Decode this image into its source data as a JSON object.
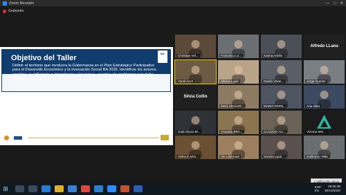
{
  "window": {
    "title": "Zoom Reunión",
    "controls": [
      "—",
      "□",
      "✕"
    ]
  },
  "recording": {
    "label": "Grabando"
  },
  "slide": {
    "title": "Objetivo del Taller",
    "logo_text": "BA",
    "body": "Definir el territorio que involucra la Gobernanza en el Plan Estratégico Participativo para el Desarrollo Económico y la Innovación Social BA 2035. Identificar los actores sociales, su influencia e importancia y los temas, asuntos y/o problemas que debe abordar."
  },
  "participants": [
    {
      "name": "Christian Vel...",
      "type": "video",
      "color": "#5b4a3a"
    },
    {
      "name": "Francisco Lo...",
      "type": "video",
      "color": "#6b6f72"
    },
    {
      "name": "Karina Arbilla",
      "type": "video",
      "color": "#4a4f58"
    },
    {
      "name": "Alfredo LLana",
      "type": "name"
    },
    {
      "name": "Yamil Asch",
      "type": "video",
      "color": "#6d5a43",
      "active": true
    },
    {
      "name": "Silvina Lupis",
      "type": "video",
      "color": "#b9a48a"
    },
    {
      "name": "Danilo Villan...",
      "type": "video",
      "color": "#5a5e66"
    },
    {
      "name": "Jorge Gomez",
      "type": "video",
      "color": "#7a7f86"
    },
    {
      "name": "Silvia Collin",
      "type": "name"
    },
    {
      "name": "Mora ARAUJO...",
      "type": "video",
      "color": "#8c7a62"
    },
    {
      "name": "MARIA FERN...",
      "type": "video",
      "color": "#4e5561"
    },
    {
      "name": "Ana Siles",
      "type": "video",
      "color": "#3b4a60"
    },
    {
      "name": "José Oscar Bl...",
      "type": "video",
      "color": "#2f3236"
    },
    {
      "name": "Graciela BRA...",
      "type": "video",
      "color": "#8a7550"
    },
    {
      "name": "CLAUDIO AU...",
      "type": "video",
      "color": "#6a6255"
    },
    {
      "name": "Victoria Mel...",
      "type": "logo",
      "color": "#1b1b1b"
    },
    {
      "name": "AMALIA MAI...",
      "type": "video",
      "color": "#6b5034"
    },
    {
      "name": "Ale Liberman",
      "type": "video",
      "color": "#9c7f5e"
    },
    {
      "name": "Sandra Aguir...",
      "type": "video",
      "color": "#5a5050"
    },
    {
      "name": "Guillermo Yella",
      "type": "video",
      "color": "#6b6e70"
    }
  ],
  "taskbar": {
    "start_icon": "windows-start-icon",
    "apps": [
      {
        "name": "search-icon",
        "color": "#3a4a5a"
      },
      {
        "name": "task-view-icon",
        "color": "#3a4a5a"
      },
      {
        "name": "edge-icon",
        "color": "#2b7bd4"
      },
      {
        "name": "file-explorer-icon",
        "color": "#e0b12e"
      },
      {
        "name": "store-icon",
        "color": "#3a7fd0"
      },
      {
        "name": "chrome-icon",
        "color": "#d94a3a"
      },
      {
        "name": "mail-icon",
        "color": "#2f7fd1"
      },
      {
        "name": "zoom-icon",
        "color": "#2d8cff"
      },
      {
        "name": "powerpoint-icon",
        "color": "#c9502e"
      },
      {
        "name": "word-icon",
        "color": "#2b5fb0"
      }
    ],
    "lang": "ESP",
    "lang2": "ES",
    "time": "09:55:39",
    "date": "30/10/2020"
  },
  "toast": {
    "text": "1 notificación nueva"
  }
}
